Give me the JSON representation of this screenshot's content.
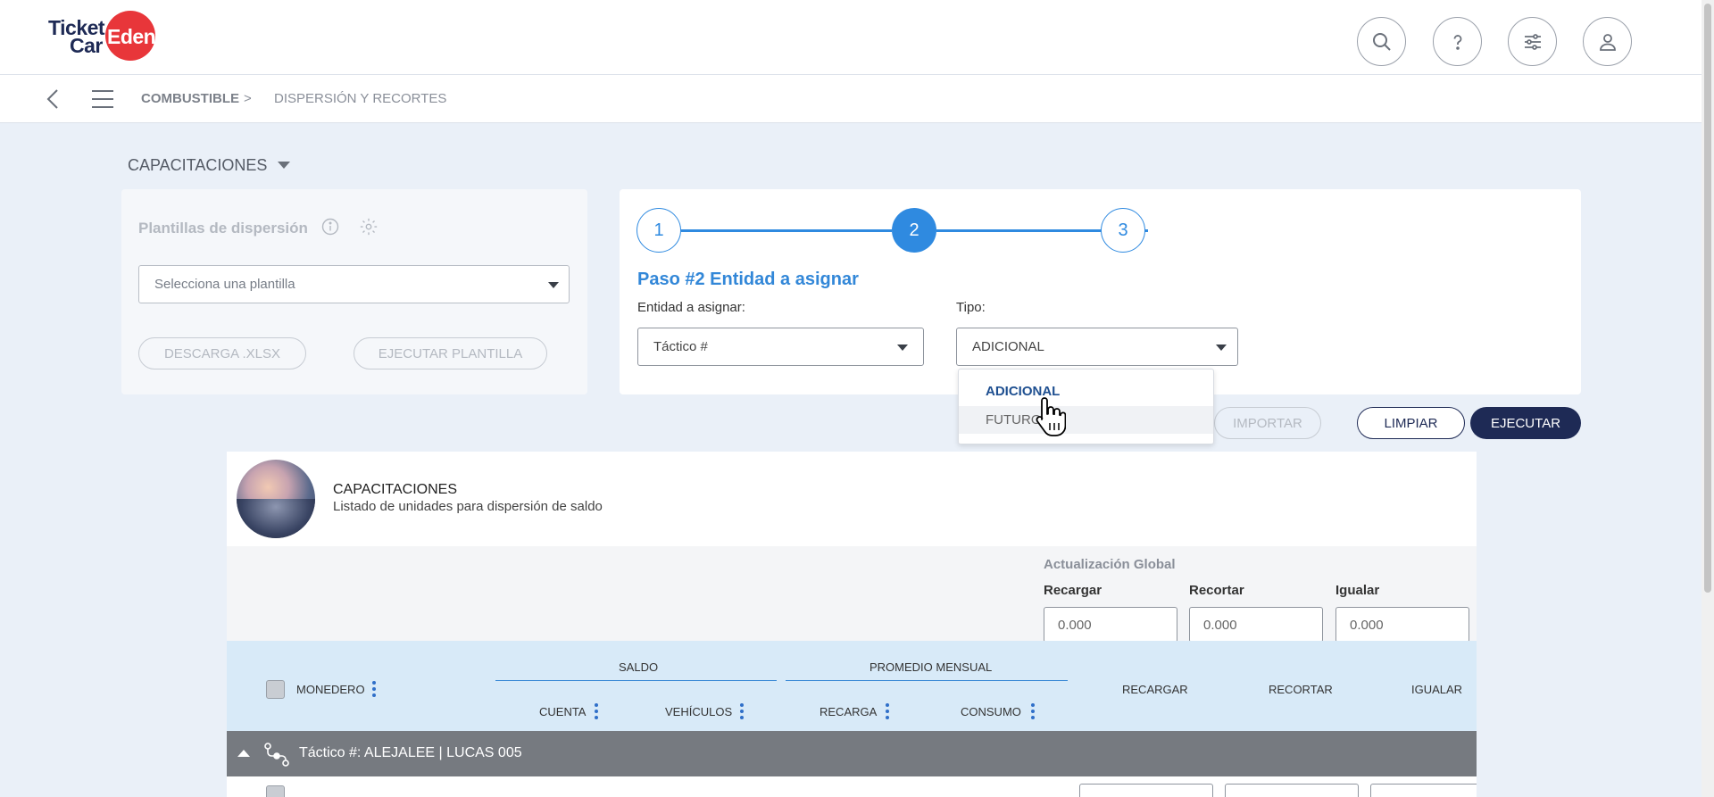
{
  "header": {
    "logo": {
      "word1": "Ticket",
      "word2": "Car",
      "brand": "Edenred"
    },
    "icons": [
      "search-icon",
      "help-icon",
      "settings-sliders-icon",
      "user-icon"
    ]
  },
  "breadcrumb": {
    "first": "COMBUSTIBLE",
    "separator": ">",
    "second": "DISPERSIÓN Y RECORTES"
  },
  "section": {
    "title": "CAPACITACIONES"
  },
  "templates_panel": {
    "title": "Plantillas de dispersión",
    "select_placeholder": "Selecciona una plantilla",
    "download_label": "DESCARGA .XLSX",
    "run_label": "EJECUTAR PLANTILLA"
  },
  "wizard": {
    "steps": [
      "1",
      "2",
      "3"
    ],
    "active_step": 2,
    "title": "Paso #2 Entidad a asignar",
    "entity_label": "Entidad a asignar:",
    "entity_value": "Táctico #",
    "type_label": "Tipo:",
    "type_value": "ADICIONAL",
    "type_options": [
      "ADICIONAL",
      "FUTURO"
    ]
  },
  "actions": {
    "import": "IMPORTAR",
    "clear": "LIMPIAR",
    "execute": "EJECUTAR"
  },
  "card": {
    "title": "CAPACITACIONES",
    "subtitle": "Listado de unidades para dispersión de saldo",
    "global": {
      "heading": "Actualización Global",
      "recargar_label": "Recargar",
      "recortar_label": "Recortar",
      "igualar_label": "Igualar",
      "recargar_value": "0.000",
      "recortar_value": "0.000",
      "igualar_value": "0.000"
    },
    "table": {
      "monedero": "MONEDERO",
      "saldo": "SALDO",
      "promedio": "PROMEDIO MENSUAL",
      "cuenta": "CUENTA",
      "vehiculos": "VEHÍCULOS",
      "recarga": "RECARGA",
      "consumo": "CONSUMO",
      "recargar": "RECARGAR",
      "recortar": "RECORTAR",
      "igualar": "IGUALAR"
    },
    "group_row": "Táctico #: ALEJALEE | LUCAS 005"
  },
  "colors": {
    "primary_blue": "#2f8ae0",
    "navy": "#1e2a55",
    "brand_red": "#e8363a"
  }
}
